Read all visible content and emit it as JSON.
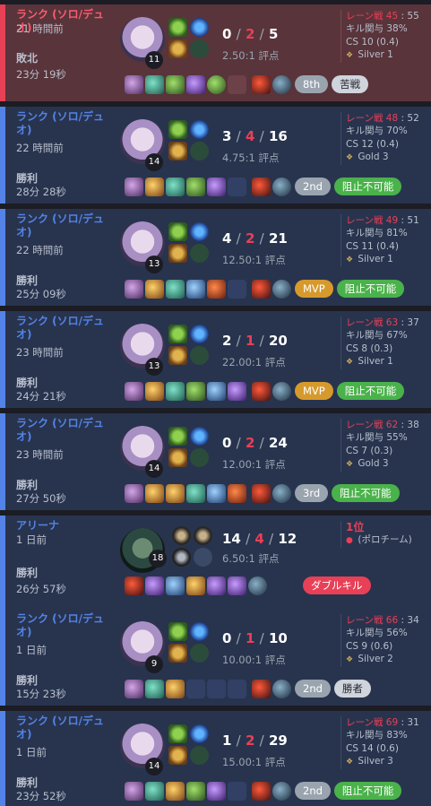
{
  "matches": [
    {
      "queue": "ランク (ソロ/デュオ)",
      "ago": "21 時間前",
      "result": "敗北",
      "duration": "23分 19秒",
      "level": "11",
      "kills": "0",
      "deaths": "2",
      "assists": "5",
      "kda_ratio": "2.50:1 評点",
      "lane_label": "レーン戦 45",
      "lane_value": "55",
      "kp": "キル関与 38%",
      "cs": "CS 10 (0.4)",
      "rank": "Silver 1",
      "placement": "8th",
      "tag": "苦戦"
    },
    {
      "queue": "ランク (ソロ/デュオ)",
      "ago": "22 時間前",
      "result": "勝利",
      "duration": "28分 28秒",
      "level": "14",
      "kills": "3",
      "deaths": "4",
      "assists": "16",
      "kda_ratio": "4.75:1 評点",
      "lane_label": "レーン戦 48",
      "lane_value": "52",
      "kp": "キル関与 70%",
      "cs": "CS 12 (0.4)",
      "rank": "Gold 3",
      "placement": "2nd",
      "tag": "阻止不可能"
    },
    {
      "queue": "ランク (ソロ/デュオ)",
      "ago": "22 時間前",
      "result": "勝利",
      "duration": "25分 09秒",
      "level": "13",
      "kills": "4",
      "deaths": "2",
      "assists": "21",
      "kda_ratio": "12.50:1 評点",
      "lane_label": "レーン戦 49",
      "lane_value": "51",
      "kp": "キル関与 81%",
      "cs": "CS 11 (0.4)",
      "rank": "Silver 1",
      "placement": "MVP",
      "tag": "阻止不可能"
    },
    {
      "queue": "ランク (ソロ/デュオ)",
      "ago": "23 時間前",
      "result": "勝利",
      "duration": "24分 21秒",
      "level": "13",
      "kills": "2",
      "deaths": "1",
      "assists": "20",
      "kda_ratio": "22.00:1 評点",
      "lane_label": "レーン戦 63",
      "lane_value": "37",
      "kp": "キル関与 67%",
      "cs": "CS 8 (0.3)",
      "rank": "Silver 1",
      "placement": "MVP",
      "tag": "阻止不可能"
    },
    {
      "queue": "ランク (ソロ/デュオ)",
      "ago": "23 時間前",
      "result": "勝利",
      "duration": "27分 50秒",
      "level": "14",
      "kills": "0",
      "deaths": "2",
      "assists": "24",
      "kda_ratio": "12.00:1 評点",
      "lane_label": "レーン戦 62",
      "lane_value": "38",
      "kp": "キル関与 55%",
      "cs": "CS 7 (0.3)",
      "rank": "Gold 3",
      "placement": "3rd",
      "tag": "阻止不可能"
    },
    {
      "queue": "アリーナ",
      "ago": "1 日前",
      "result": "勝利",
      "duration": "26分 57秒",
      "level": "18",
      "kills": "14",
      "deaths": "4",
      "assists": "12",
      "kda_ratio": "6.50:1 評点",
      "arena_place": "1位",
      "arena_team": "(ポロチーム)",
      "tag": "ダブルキル"
    },
    {
      "queue": "ランク (ソロ/デュオ)",
      "ago": "1 日前",
      "result": "勝利",
      "duration": "15分 23秒",
      "level": "9",
      "kills": "0",
      "deaths": "1",
      "assists": "10",
      "kda_ratio": "10.00:1 評点",
      "lane_label": "レーン戦 66",
      "lane_value": "34",
      "kp": "キル関与 56%",
      "cs": "CS 9 (0.6)",
      "rank": "Silver 2",
      "placement": "2nd",
      "tag": "勝者"
    },
    {
      "queue": "ランク (ソロ/デュオ)",
      "ago": "1 日前",
      "result": "勝利",
      "duration": "23分 52秒",
      "level": "14",
      "kills": "1",
      "deaths": "2",
      "assists": "29",
      "kda_ratio": "15.00:1 評点",
      "lane_label": "レーン戦 69",
      "lane_value": "31",
      "kp": "キル関与 83%",
      "cs": "CS 14 (0.6)",
      "rank": "Silver 3",
      "placement": "2nd",
      "tag": "阻止不可能"
    }
  ],
  "colors": {
    "win": "#5383e8",
    "loss": "#e84057",
    "win_bg": "#28344e",
    "loss_bg": "#59343b"
  }
}
